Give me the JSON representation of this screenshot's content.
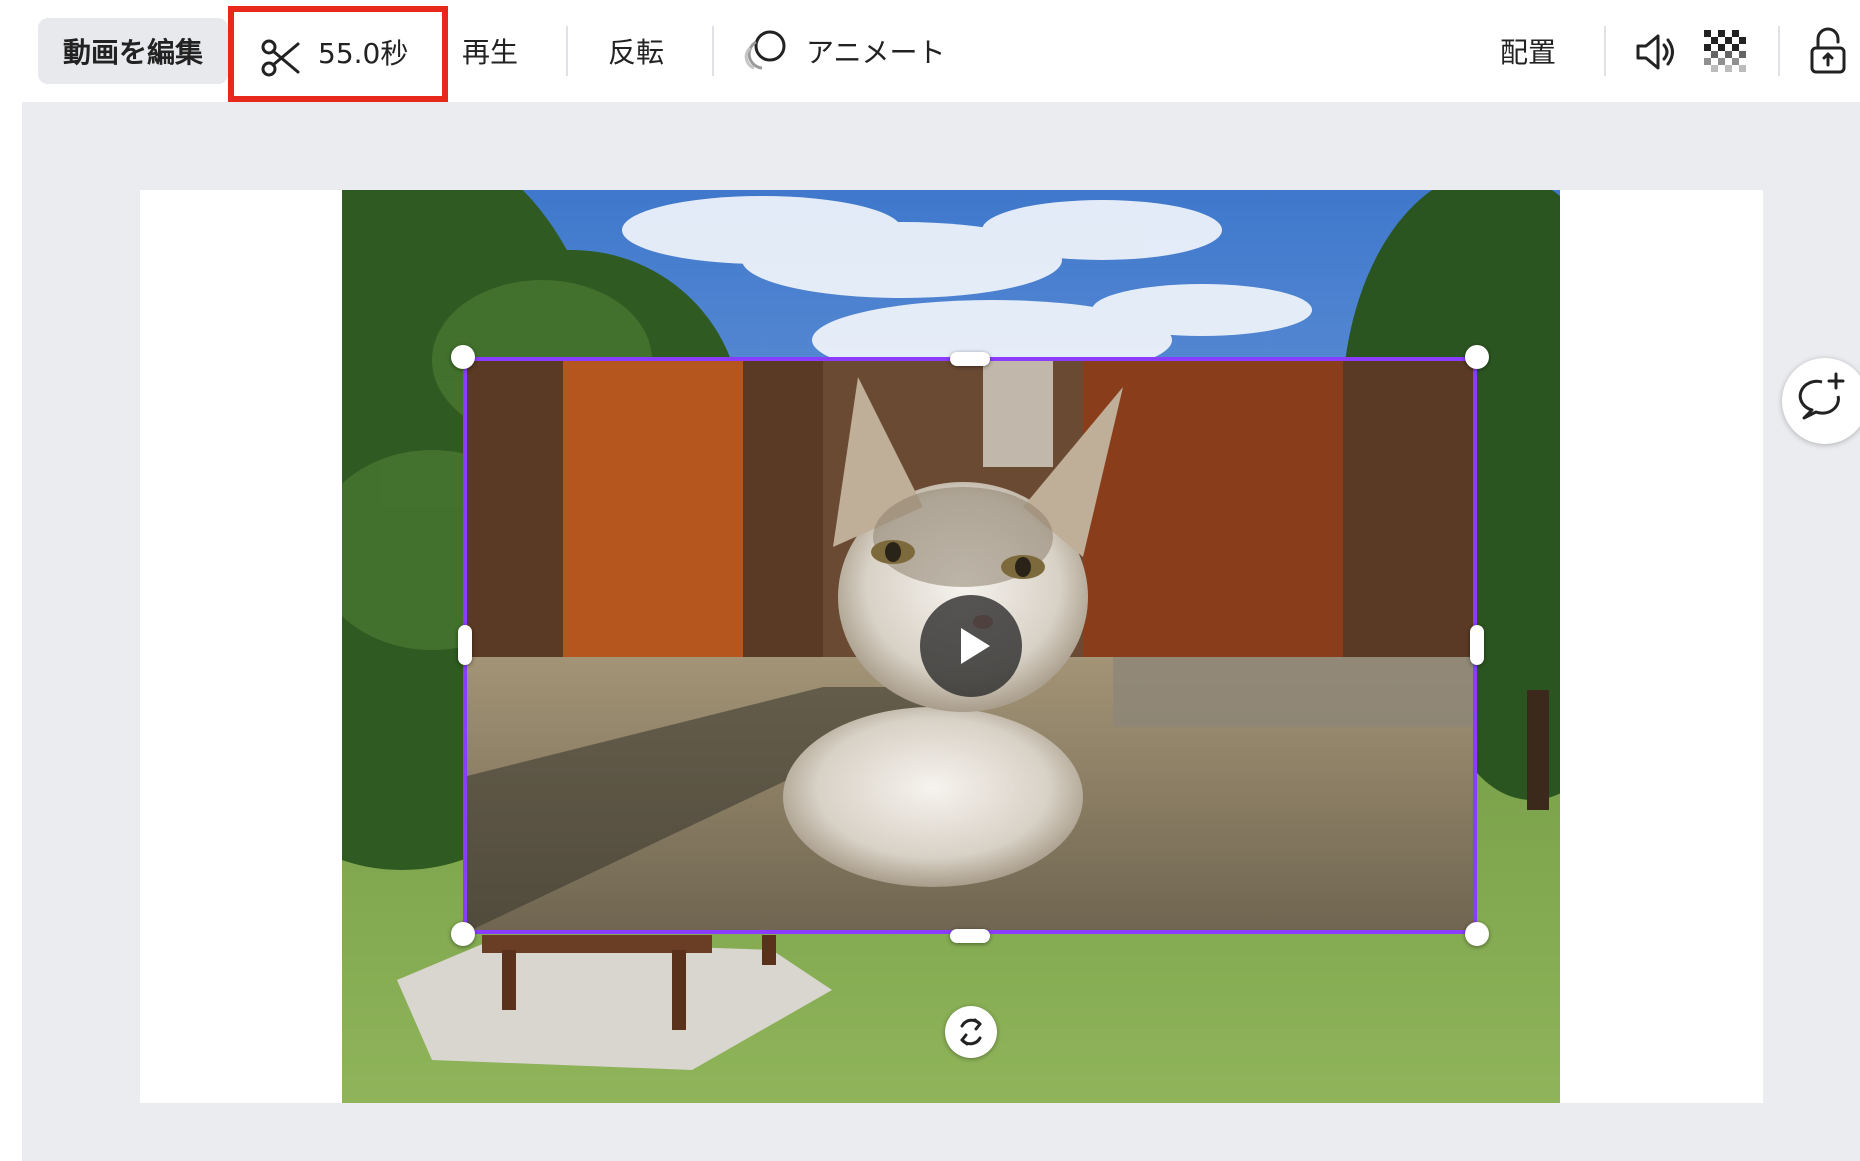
{
  "toolbar": {
    "edit_video_label": "動画を編集",
    "trim_duration": "55.0秒",
    "play_label": "再生",
    "flip_label": "反転",
    "animate_label": "アニメート",
    "position_label": "配置",
    "icons": {
      "trim": "scissors-icon",
      "animate": "animate-icon",
      "volume": "speaker-icon",
      "transparency": "transparency-icon",
      "lock": "lock-icon"
    }
  },
  "canvas": {
    "background_color": "#ebecef",
    "page_color": "#ffffff",
    "selection_color": "#8b3dff",
    "highlight_color": "#e8281b",
    "play_icon": "play-icon",
    "rotate_icon": "rotate-icon",
    "comment_icon": "add-comment-icon"
  }
}
